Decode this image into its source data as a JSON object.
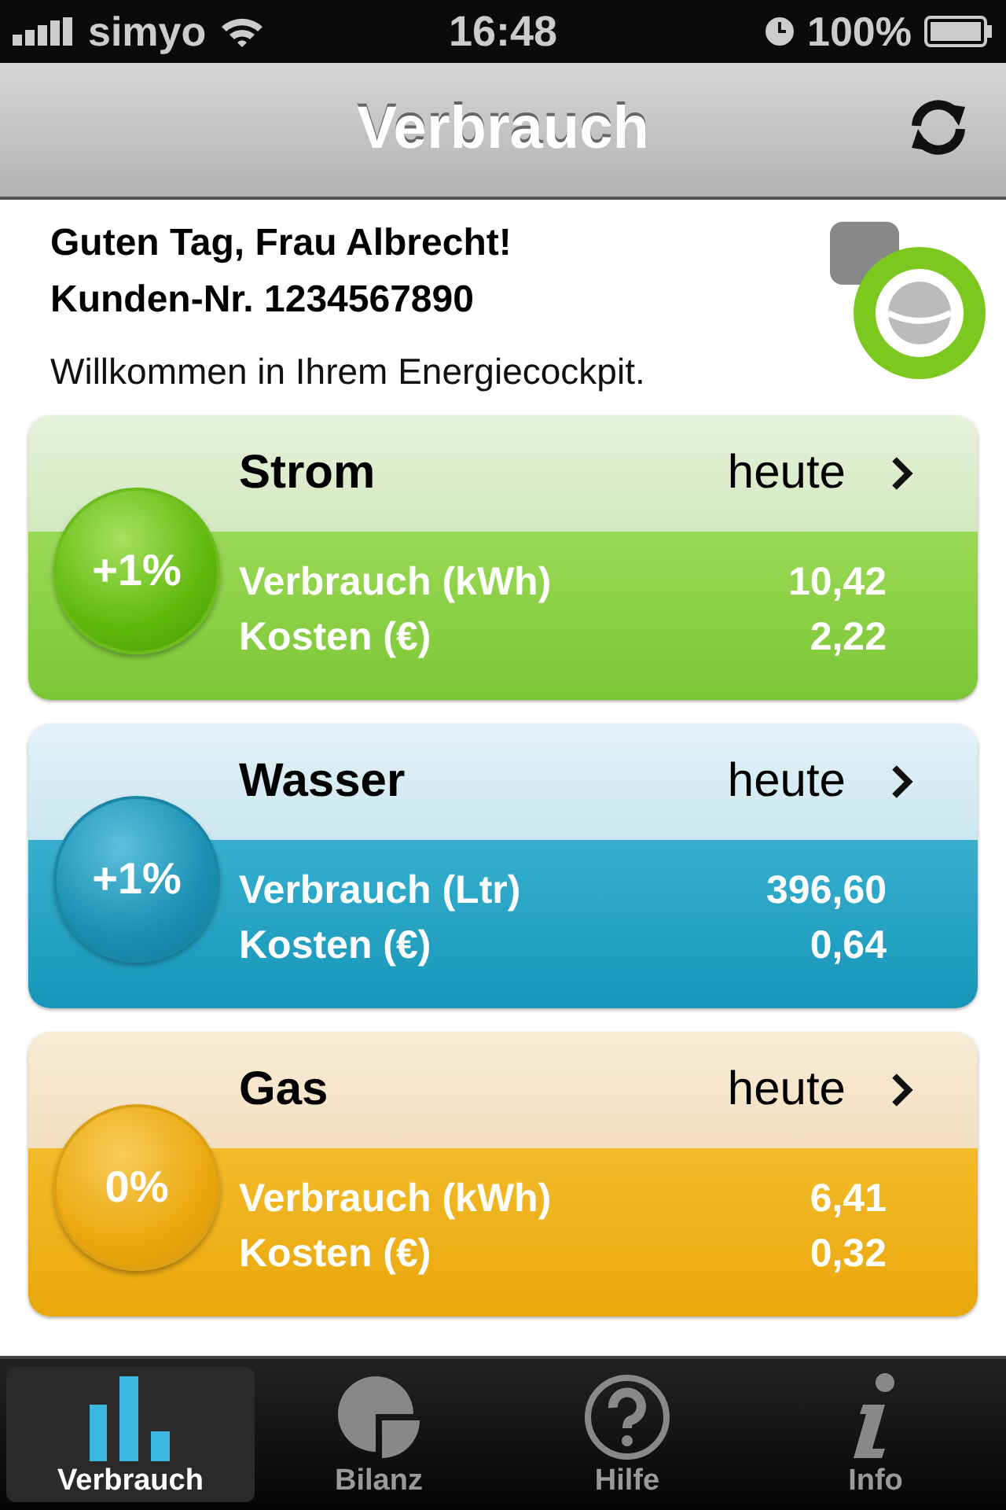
{
  "status_bar": {
    "carrier": "simyo",
    "time": "16:48",
    "battery": "100%"
  },
  "nav_bar": {
    "title": "Verbrauch"
  },
  "greeting": {
    "line1": "Guten Tag, Frau Albrecht!",
    "line2": "Kunden-Nr. 1234567890",
    "welcome": "Willkommen in Ihrem Energiecockpit."
  },
  "cards": [
    {
      "kind": "electricity",
      "title": "Strom",
      "period": "heute",
      "change": "+1%",
      "rows": [
        {
          "label": "Verbrauch (kWh)",
          "value": "10,42"
        },
        {
          "label": "Kosten (€)",
          "value": "2,22"
        }
      ]
    },
    {
      "kind": "water",
      "title": "Wasser",
      "period": "heute",
      "change": "+1%",
      "rows": [
        {
          "label": "Verbrauch (Ltr)",
          "value": "396,60"
        },
        {
          "label": "Kosten (€)",
          "value": "0,64"
        }
      ]
    },
    {
      "kind": "gas",
      "title": "Gas",
      "period": "heute",
      "change": "0%",
      "rows": [
        {
          "label": "Verbrauch (kWh)",
          "value": "6,41"
        },
        {
          "label": "Kosten (€)",
          "value": "0,32"
        }
      ]
    }
  ],
  "tab_bar": [
    {
      "kind": "chart",
      "label": "Verbrauch",
      "selected": true
    },
    {
      "kind": "pie",
      "label": "Bilanz",
      "selected": false
    },
    {
      "kind": "help",
      "label": "Hilfe",
      "selected": false
    },
    {
      "kind": "info",
      "label": "Info",
      "selected": false
    }
  ]
}
